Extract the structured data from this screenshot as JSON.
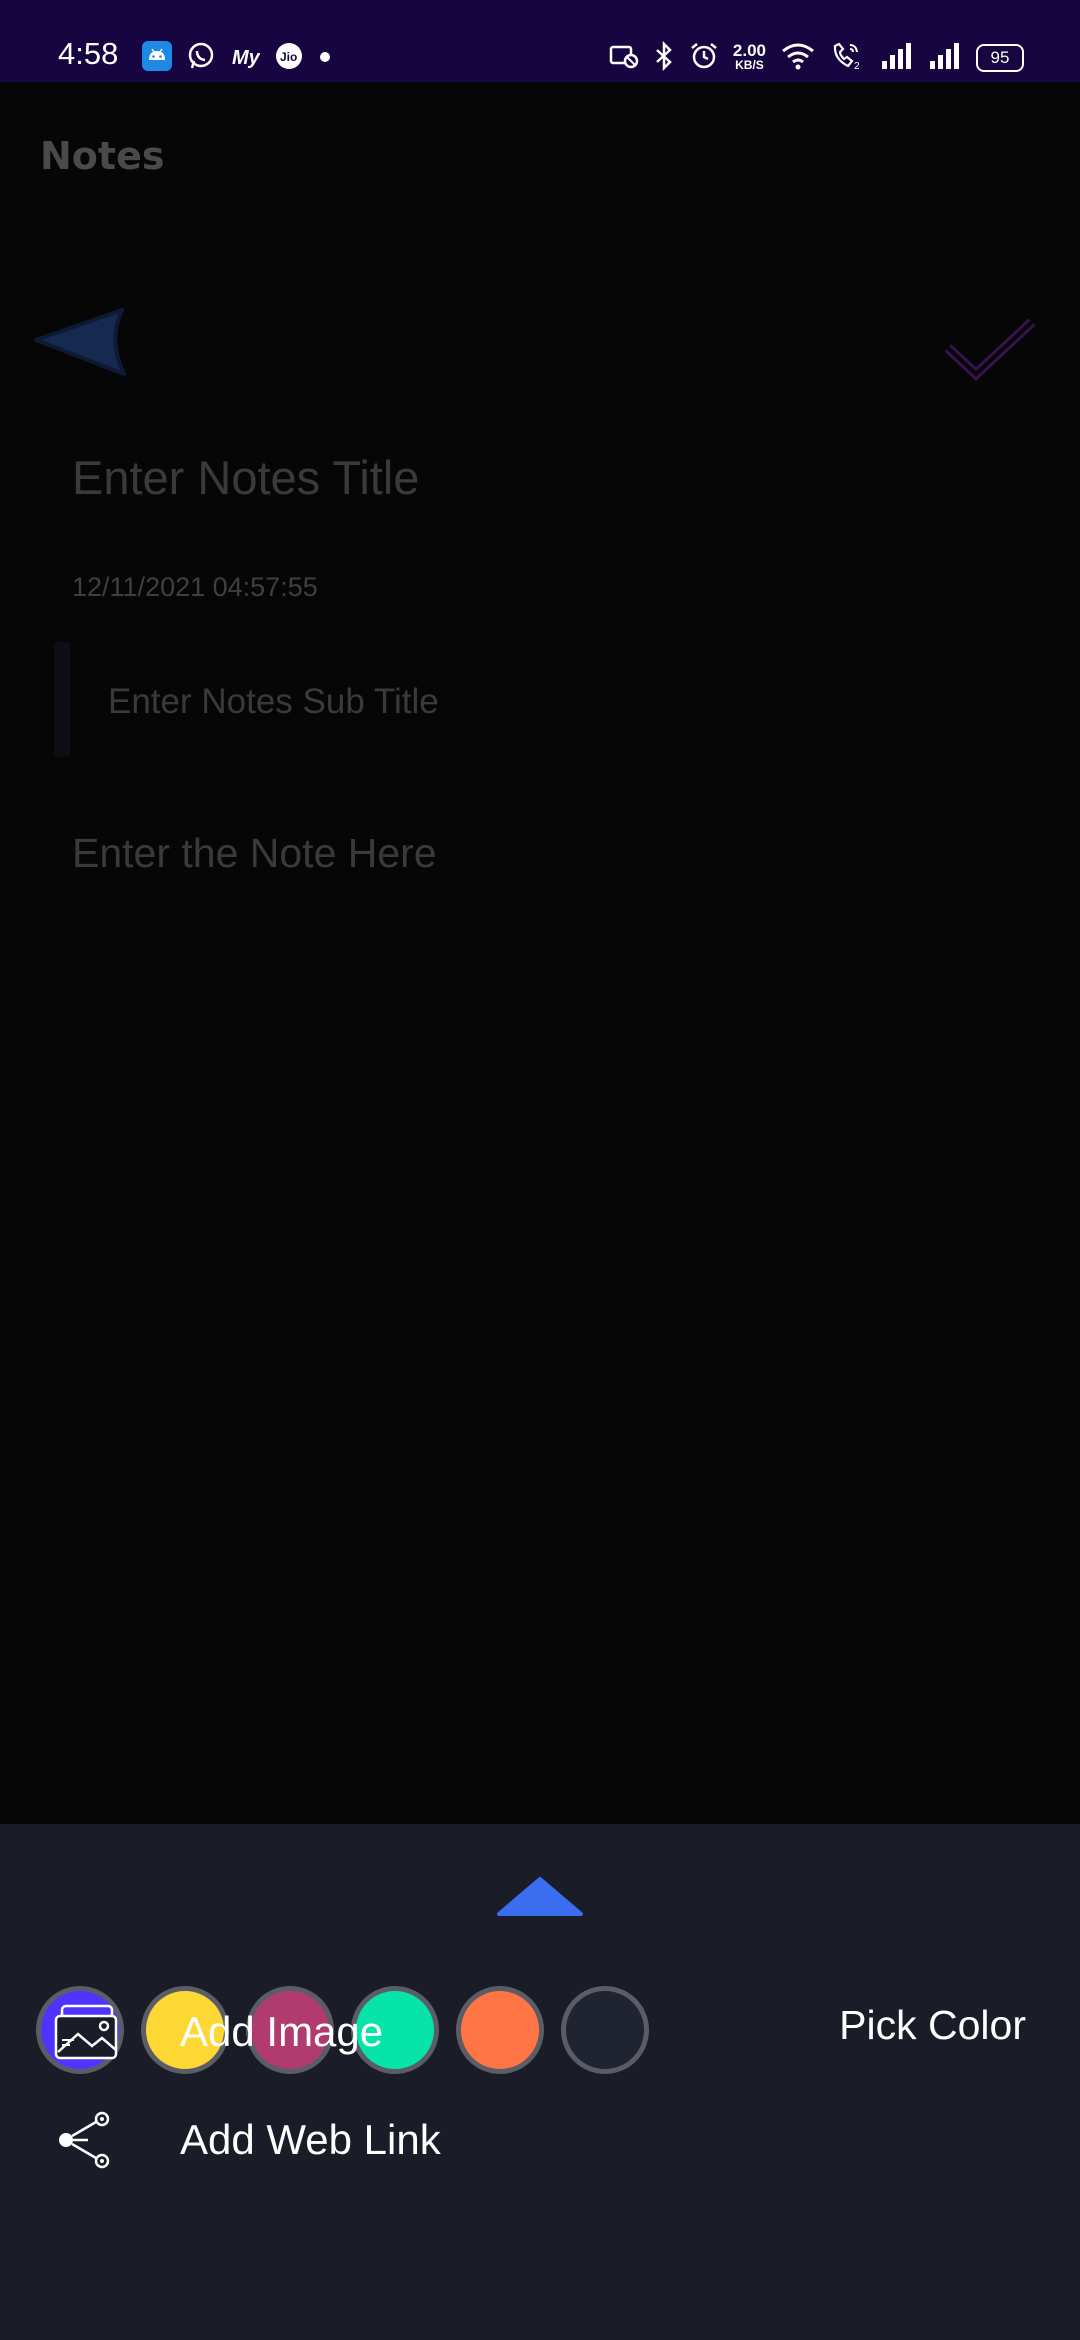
{
  "status_bar": {
    "time": "4:58",
    "net_speed_value": "2.00",
    "net_speed_unit": "KB/S",
    "battery": "95",
    "left_icons": [
      "android-icon",
      "whatsapp-icon",
      "myjio-icon",
      "jio-icon",
      "notification-dot-icon"
    ],
    "right_icons": [
      "no-sim-icon",
      "bluetooth-icon",
      "alarm-icon",
      "wifi-icon",
      "volte-call-icon",
      "signal-1-icon",
      "signal-2-icon"
    ]
  },
  "app": {
    "title": "Notes"
  },
  "editor": {
    "title_placeholder": "Enter Notes Title",
    "datetime": "12/11/2021 04:57:55",
    "subtitle_placeholder": "Enter Notes Sub Title",
    "body_placeholder": "Enter the Note Here",
    "back_icon": "back-arrow-icon",
    "done_icon": "checkmark-icon"
  },
  "bottom_sheet": {
    "handle_icon": "chevron-up-icon",
    "color_options": [
      {
        "name": "purple",
        "hex": "#4f33ff"
      },
      {
        "name": "yellow",
        "hex": "#fdd835"
      },
      {
        "name": "magenta",
        "hex": "#b13b6e"
      },
      {
        "name": "teal",
        "hex": "#07e4a9"
      },
      {
        "name": "orange",
        "hex": "#ff7545"
      },
      {
        "name": "default",
        "hex": "#1f2430"
      }
    ],
    "pick_color_label": "Pick Color",
    "actions": {
      "add_image_label": "Add Image",
      "add_web_link_label": "Add Web Link"
    }
  },
  "colors": {
    "status_bar_bg": "#160540",
    "sheet_bg": "#1a1d27",
    "accent_blue": "#3a6df0",
    "check_purple": "#7b1fa2"
  }
}
